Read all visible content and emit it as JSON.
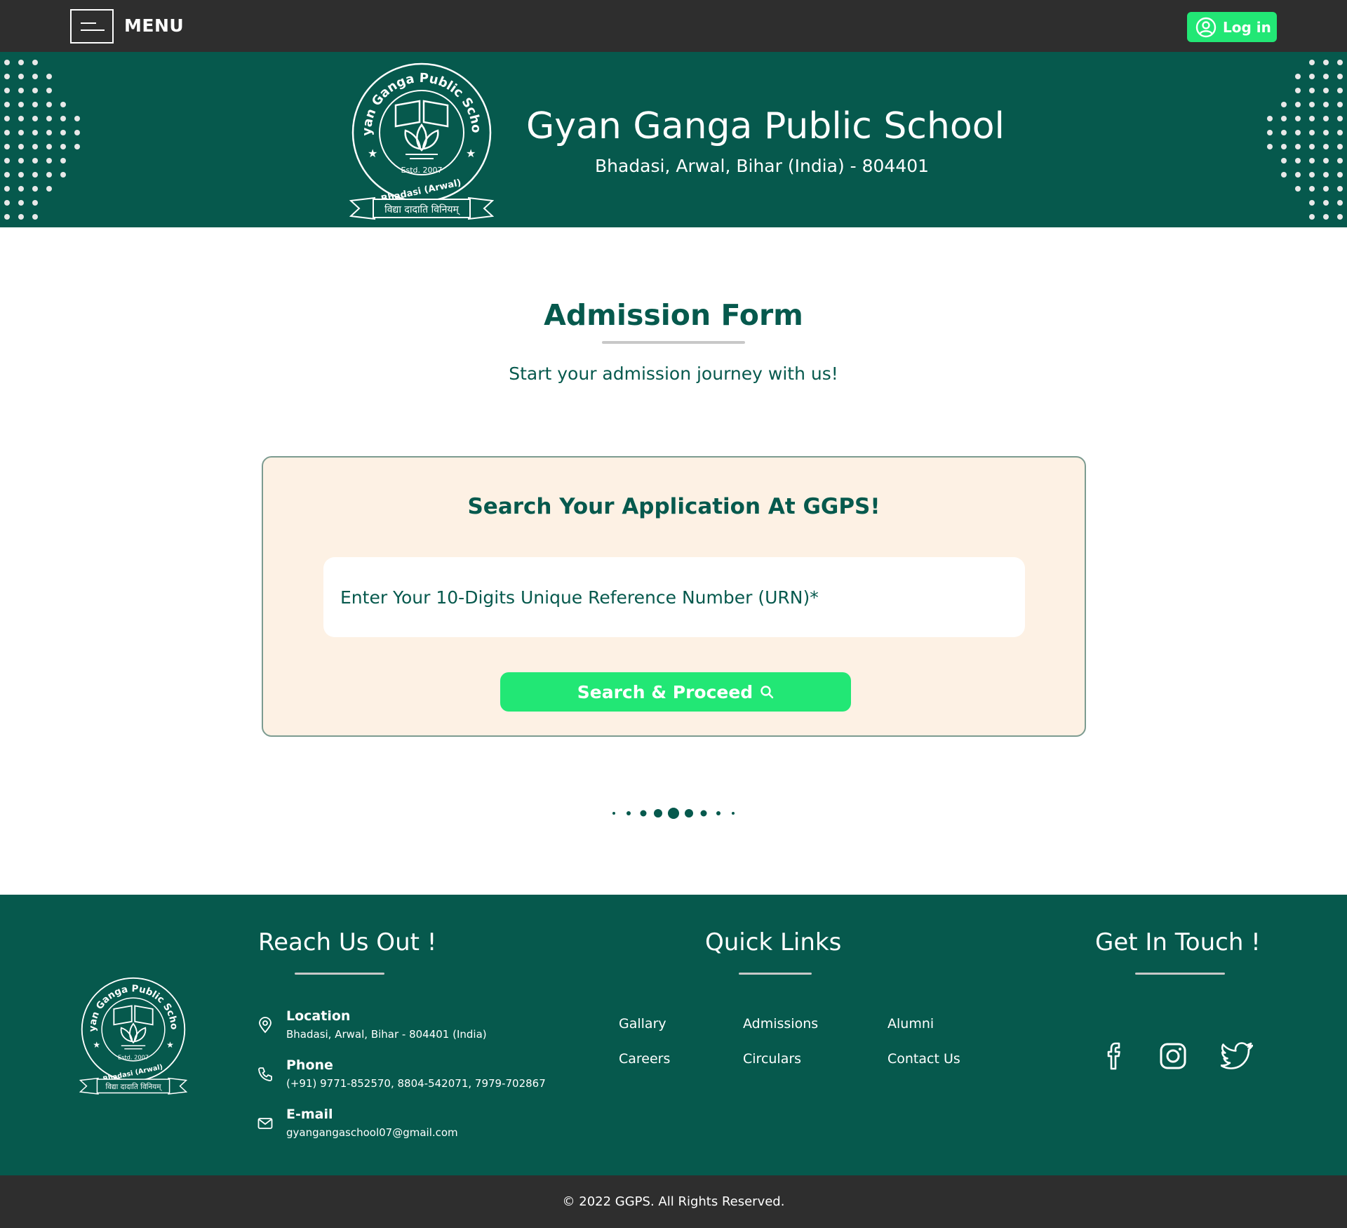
{
  "topbar": {
    "menu_label": "MENU",
    "login_label": "Log in",
    "login_color": "#22e775"
  },
  "header": {
    "school_name": "Gyan Ganga Public School",
    "address": "Bhadasi, Arwal, Bihar (India) - 804401",
    "logo": {
      "ring_text": "Gyan Ganga Public School",
      "estd": "Estd. 2007",
      "place": "Bhadasi (Arwal)",
      "motto": "विद्या दादाति विनियम्"
    },
    "bg_color": "#06594d"
  },
  "main": {
    "title": "Admission Form",
    "subtitle": "Start your admission journey with us!",
    "card": {
      "title": "Search Your Application At GGPS!",
      "urn_placeholder": "Enter Your 10-Digits Unique Reference Number (URN)*",
      "search_button": "Search & Proceed",
      "search_icon": "search-icon"
    }
  },
  "footer": {
    "reach_title": "Reach Us Out !",
    "contacts": [
      {
        "icon": "location-pin-icon",
        "title": "Location",
        "value": "Bhadasi, Arwal, Bihar - 804401 (India)"
      },
      {
        "icon": "phone-icon",
        "title": "Phone",
        "value": "(+91) 9771-852570, 8804-542071, 7979-702867"
      },
      {
        "icon": "mail-icon",
        "title": "E-mail",
        "value": "gyangangaschool07@gmail.com"
      }
    ],
    "links_title": "Quick Links",
    "links": [
      "Gallary",
      "Admissions",
      "Alumni",
      "Careers",
      "Circulars",
      "Contact Us"
    ],
    "touch_title": "Get In Touch !",
    "socials": [
      "facebook-icon",
      "instagram-icon",
      "twitter-icon"
    ],
    "copyright": "© 2022 GGPS. All Rights Reserved."
  }
}
